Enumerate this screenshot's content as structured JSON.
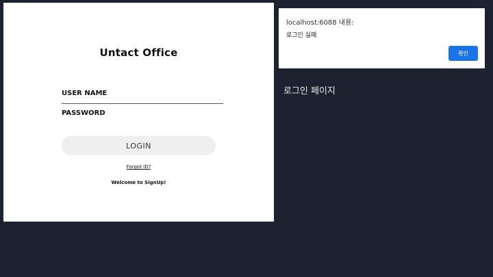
{
  "login_form": {
    "title": "Untact Office",
    "username_placeholder": "USER NAME",
    "password_placeholder": "PASSWORD",
    "login_label": "LOGIN",
    "forgot_label": "Forgot ID?",
    "signup_text": "Welcome to SignUp!"
  },
  "alert": {
    "header": "localhost:6088 내용:",
    "message": "로그인 실패",
    "ok_label": "확인"
  },
  "page": {
    "caption": "로그인 페이지"
  },
  "colors": {
    "background": "#1c2230",
    "panel": "#ffffff",
    "login_button": "#efefef",
    "alert_ok_button": "#1a73e8"
  }
}
